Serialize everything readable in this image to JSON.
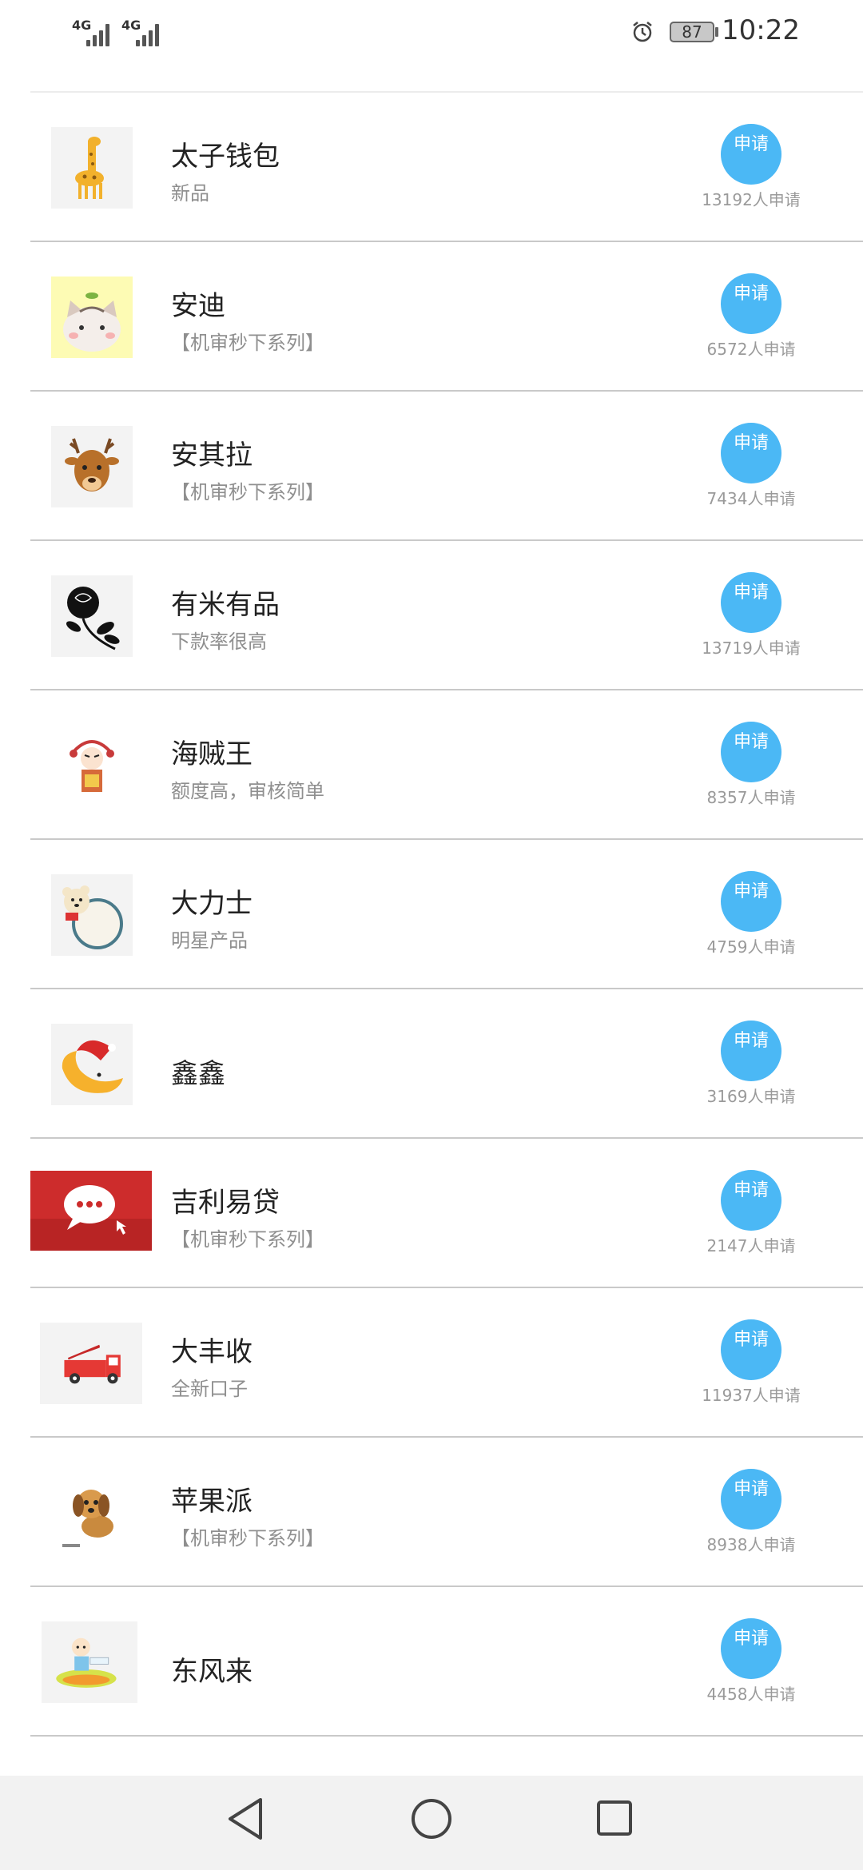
{
  "status_bar": {
    "sim1": "4G",
    "sim2": "4G",
    "battery": "87",
    "time": "10:22"
  },
  "products": [
    {
      "name": "太子钱包",
      "desc": "新品",
      "button": "申请",
      "count": "13192人申请",
      "icon": "giraffe-icon"
    },
    {
      "name": "安迪",
      "desc": "【机审秒下系列】",
      "button": "申请",
      "count": "6572人申请",
      "icon": "cat-icon"
    },
    {
      "name": "安其拉",
      "desc": "【机审秒下系列】",
      "button": "申请",
      "count": "7434人申请",
      "icon": "deer-icon"
    },
    {
      "name": "有米有品",
      "desc": "下款率很高",
      "button": "申请",
      "count": "13719人申请",
      "icon": "rose-icon"
    },
    {
      "name": "海贼王",
      "desc": "额度高，审核简单",
      "button": "申请",
      "count": "8357人申请",
      "icon": "opera-figure-icon"
    },
    {
      "name": "大力士",
      "desc": "明星产品",
      "button": "申请",
      "count": "4759人申请",
      "icon": "bear-icon"
    },
    {
      "name": "鑫鑫",
      "desc": "",
      "button": "申请",
      "count": "3169人申请",
      "icon": "moon-icon"
    },
    {
      "name": "吉利易贷",
      "desc": "【机审秒下系列】",
      "button": "申请",
      "count": "2147人申请",
      "icon": "chat-bubble-icon"
    },
    {
      "name": "大丰收",
      "desc": "全新口子",
      "button": "申请",
      "count": "11937人申请",
      "icon": "fire-truck-icon"
    },
    {
      "name": "苹果派",
      "desc": "【机审秒下系列】",
      "button": "申请",
      "count": "8938人申请",
      "icon": "puppy-icon"
    },
    {
      "name": "东风来",
      "desc": "",
      "button": "申请",
      "count": "4458人申请",
      "icon": "baby-icon"
    }
  ],
  "colors": {
    "accent": "#4bb8f5",
    "divider": "#c9c9c9",
    "subtext": "#8f8f8f"
  }
}
